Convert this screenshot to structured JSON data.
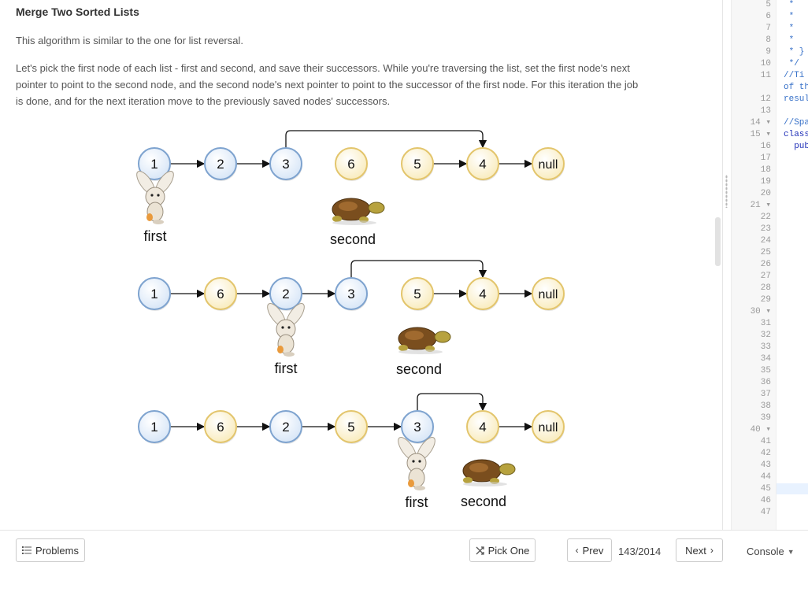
{
  "problem": {
    "title": "Merge Two Sorted Lists",
    "intro": "This algorithm is similar to the one for list reversal.",
    "body_line1": "Let's pick the first node of each list - first and second, and save their successors. While you're traversing the list, set the first node's next",
    "body_line2": "pointer to point to the second node, and the second node's next pointer to point to the successor of the first node. For this iteration the job",
    "body_line3": "is done, and for the next iteration move to the previously saved nodes' successors."
  },
  "diagram": {
    "rows": [
      {
        "nodes": [
          {
            "label": "1",
            "color": "blue"
          },
          {
            "label": "2",
            "color": "blue"
          },
          {
            "label": "3",
            "color": "blue"
          },
          {
            "label": "6",
            "color": "yellow"
          },
          {
            "label": "5",
            "color": "yellow"
          },
          {
            "label": "4",
            "color": "yellow"
          },
          {
            "label": "null",
            "color": "yellow"
          }
        ],
        "first_label": "first",
        "second_label": "second"
      },
      {
        "nodes": [
          {
            "label": "1",
            "color": "blue"
          },
          {
            "label": "6",
            "color": "yellow"
          },
          {
            "label": "2",
            "color": "blue"
          },
          {
            "label": "3",
            "color": "blue"
          },
          {
            "label": "5",
            "color": "yellow"
          },
          {
            "label": "4",
            "color": "yellow"
          },
          {
            "label": "null",
            "color": "yellow"
          }
        ],
        "first_label": "first",
        "second_label": "second"
      },
      {
        "nodes": [
          {
            "label": "1",
            "color": "blue"
          },
          {
            "label": "6",
            "color": "yellow"
          },
          {
            "label": "2",
            "color": "blue"
          },
          {
            "label": "5",
            "color": "yellow"
          },
          {
            "label": "3",
            "color": "blue"
          },
          {
            "label": "4",
            "color": "yellow"
          },
          {
            "label": "null",
            "color": "yellow"
          }
        ],
        "first_label": "first",
        "second_label": "second"
      }
    ],
    "colors": {
      "blue_fill": "#e6f0fb",
      "blue_stroke": "#7ea3cf",
      "yellow_fill": "#fdf4d7",
      "yellow_stroke": "#e3c56c"
    }
  },
  "editor": {
    "line_numbers": [
      "5",
      "6",
      "7",
      "8",
      "9",
      "10",
      "11",
      "",
      "12",
      "13",
      "14 ▾",
      "15 ▾",
      "16",
      "17",
      "18",
      "19",
      "20",
      "21 ▾",
      "22",
      "23",
      "24",
      "25",
      "26",
      "27",
      "28",
      "29",
      "30 ▾",
      "31",
      "32",
      "33",
      "34",
      "35",
      "36",
      "37",
      "38",
      "39",
      "40 ▾",
      "41",
      "42",
      "43",
      "44",
      "45",
      "46",
      "47"
    ],
    "code_fragments": [
      {
        "text": " *",
        "row": 0,
        "cls": "c-comment"
      },
      {
        "text": " *",
        "row": 1,
        "cls": "c-comment"
      },
      {
        "text": " *",
        "row": 2,
        "cls": "c-comment"
      },
      {
        "text": " *",
        "row": 3,
        "cls": "c-comment"
      },
      {
        "text": " * }",
        "row": 4,
        "cls": "c-comment"
      },
      {
        "text": " */",
        "row": 5,
        "cls": "c-comment"
      },
      {
        "text": "//Ti",
        "row": 6,
        "cls": "c-comment"
      },
      {
        "text": "of th",
        "row": 7,
        "cls": "c-comment"
      },
      {
        "text": "resul",
        "row": 8,
        "cls": "c-comment"
      },
      {
        "text": "//Spa",
        "row": 10,
        "cls": "c-comment"
      },
      {
        "text": "class",
        "row": 11,
        "cls": "c-kw"
      },
      {
        "text": "  pub",
        "row": 12,
        "cls": "c-kw"
      }
    ]
  },
  "bottom_bar": {
    "problems_label": "Problems",
    "pick_label": "Pick One",
    "prev_label": "Prev",
    "counter": "143/2014",
    "next_label": "Next",
    "console_label": "Console"
  },
  "icons": {
    "problems": "list-icon",
    "pick": "shuffle-icon",
    "prev": "chevron-left-icon",
    "next": "chevron-right-icon",
    "console": "caret-down-icon"
  }
}
